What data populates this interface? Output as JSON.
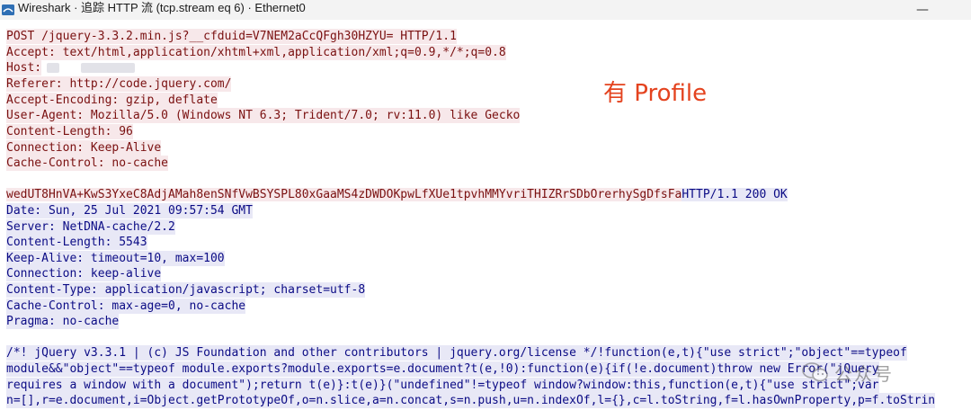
{
  "window": {
    "title": "Wireshark · 追踪 HTTP 流 (tcp.stream eq 6) · Ethernet0",
    "minimize_label": "—"
  },
  "annotation": "有 Profile",
  "stream": {
    "request": [
      "POST /jquery-3.3.2.min.js?__cfduid=V7NEM2aCcQFgh30HZYU= HTTP/1.1",
      "Accept: text/html,application/xhtml+xml,application/xml;q=0.9,*/*;q=0.8",
      "Host:",
      "Referer: http://code.jquery.com/",
      "Accept-Encoding: gzip, deflate",
      "User-Agent: Mozilla/5.0 (Windows NT 6.3; Trident/7.0; rv:11.0) like Gecko",
      "Content-Length: 96",
      "Connection: Keep-Alive",
      "Cache-Control: no-cache"
    ],
    "request_body": "wedUT8HnVA+KwS3YxeC8AdjAMah8enSNfVwBSYSPL80xGaaMS4zDWDOKpwLfXUe1tpvhMMYvriTHIZRrSDbOrerhySgDfsFa",
    "response_status": "HTTP/1.1 200 OK",
    "response_headers": [
      "Date: Sun, 25 Jul 2021 09:57:54 GMT",
      "Server: NetDNA-cache/2.2",
      "Content-Length: 5543",
      "Keep-Alive: timeout=10, max=100",
      "Connection: keep-alive",
      "Content-Type: application/javascript; charset=utf-8",
      "Cache-Control: max-age=0, no-cache",
      "Pragma: no-cache"
    ],
    "response_body": [
      "/*! jQuery v3.3.1 | (c) JS Foundation and other contributors | jquery.org/license */!function(e,t){\"use strict\";\"object\"==typeof",
      "module&&\"object\"==typeof module.exports?module.exports=e.document?t(e,!0):function(e){if(!e.document)throw new Error(\"jQuery",
      "requires a window with a document\");return t(e)}:t(e)}(\"undefined\"!=typeof window?window:this,function(e,t){\"use strict\";var",
      "n=[],r=e.document,i=Object.getPrototypeOf,o=n.slice,a=n.concat,s=n.push,u=n.indexOf,l={},c=l.toString,f=l.hasOwnProperty,p=f.toStrin"
    ]
  },
  "watermark": "公众号"
}
